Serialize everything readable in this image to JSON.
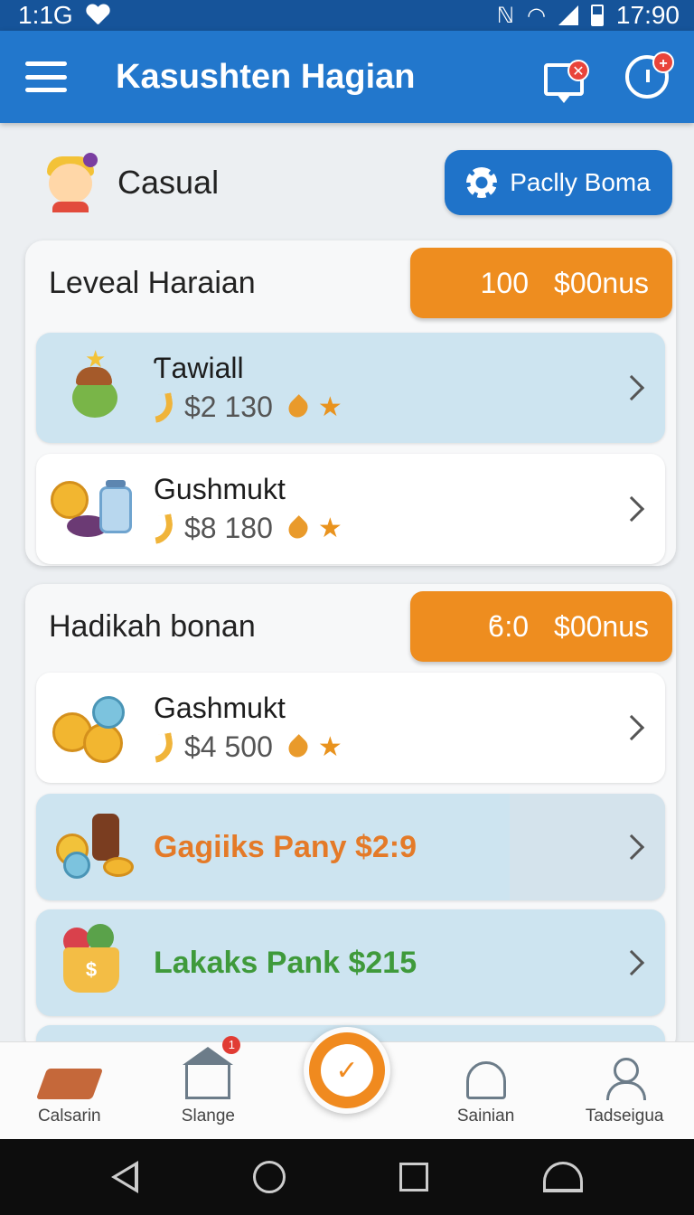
{
  "status_bar": {
    "left_text": "1:1G",
    "time": "17:90"
  },
  "app_bar": {
    "title": "Kasushten Hagian",
    "chat_badge": "✕",
    "timer_badge": "+"
  },
  "mode": {
    "label": "Casual",
    "settings_button": "Paclly Boma"
  },
  "panels": [
    {
      "title": "Leveal Haraian",
      "bonus_amount": "100",
      "bonus_label": "$00nus",
      "items": [
        {
          "name": "Ƭawiall",
          "price": "$2 130"
        },
        {
          "name": "Gushmukt",
          "price": "$8 180"
        }
      ]
    },
    {
      "title": "Hadikah bonan",
      "bonus_amount": "ϐ:0",
      "bonus_label": "$00nus",
      "items": [
        {
          "name": "Gashmukt",
          "price": "$4 500"
        }
      ],
      "promos": [
        {
          "text": "Gagiiks Pany $2:9",
          "color": "#e47a28"
        },
        {
          "text": "Lakaks Pank $215",
          "color": "#3f9a3b"
        }
      ]
    }
  ],
  "bottom_nav": {
    "items": [
      "Calsarin",
      "Slange",
      "Sainian",
      "Tadseigua"
    ],
    "slange_badge": "1",
    "fab_icon": "check-icon"
  },
  "colors": {
    "primary": "#2277cc",
    "accent": "#ee8d1f",
    "status": "#16549a"
  }
}
